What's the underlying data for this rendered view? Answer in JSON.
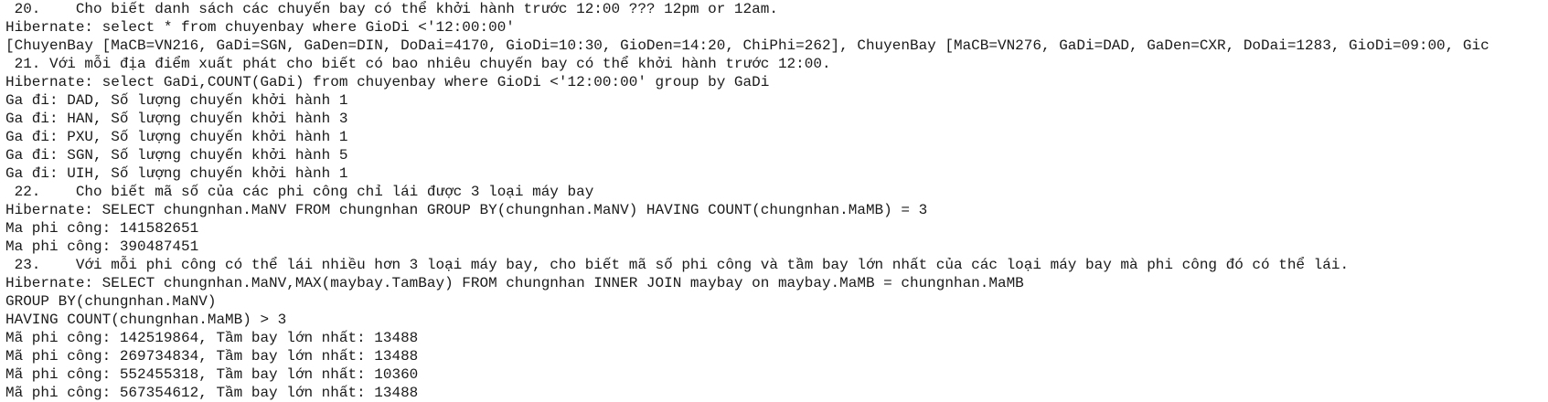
{
  "console": {
    "lines": [
      " 20.    Cho biết danh sách các chuyến bay có thể khởi hành trước 12:00 ??? 12pm or 12am.",
      "Hibernate: select * from chuyenbay where GioDi <'12:00:00'",
      "[ChuyenBay [MaCB=VN216, GaDi=SGN, GaDen=DIN, DoDai=4170, GioDi=10:30, GioDen=14:20, ChiPhi=262], ChuyenBay [MaCB=VN276, GaDi=DAD, GaDen=CXR, DoDai=1283, GioDi=09:00, Gic",
      " 21. Với mỗi địa điểm xuất phát cho biết có bao nhiêu chuyến bay có thể khởi hành trước 12:00.",
      "Hibernate: select GaDi,COUNT(GaDi) from chuyenbay where GioDi <'12:00:00' group by GaDi",
      "Ga đi: DAD, Số lượng chuyến khởi hành 1",
      "Ga đi: HAN, Số lượng chuyến khởi hành 3",
      "Ga đi: PXU, Số lượng chuyến khởi hành 1",
      "Ga đi: SGN, Số lượng chuyến khởi hành 5",
      "Ga đi: UIH, Số lượng chuyến khởi hành 1",
      " 22.    Cho biết mã số của các phi công chỉ lái được 3 loại máy bay",
      "Hibernate: SELECT chungnhan.MaNV FROM chungnhan GROUP BY(chungnhan.MaNV) HAVING COUNT(chungnhan.MaMB) = 3",
      "Ma phi công: 141582651",
      "Ma phi công: 390487451",
      " 23.    Với mỗi phi công có thể lái nhiều hơn 3 loại máy bay, cho biết mã số phi công và tầm bay lớn nhất của các loại máy bay mà phi công đó có thể lái.",
      "Hibernate: SELECT chungnhan.MaNV,MAX(maybay.TamBay) FROM chungnhan INNER JOIN maybay on maybay.MaMB = chungnhan.MaMB",
      "GROUP BY(chungnhan.MaNV)",
      "HAVING COUNT(chungnhan.MaMB) > 3",
      "Mã phi công: 142519864, Tầm bay lớn nhất: 13488",
      "Mã phi công: 269734834, Tầm bay lớn nhất: 13488",
      "Mã phi công: 552455318, Tầm bay lớn nhất: 10360",
      "Mã phi công: 567354612, Tầm bay lớn nhất: 13488"
    ]
  }
}
